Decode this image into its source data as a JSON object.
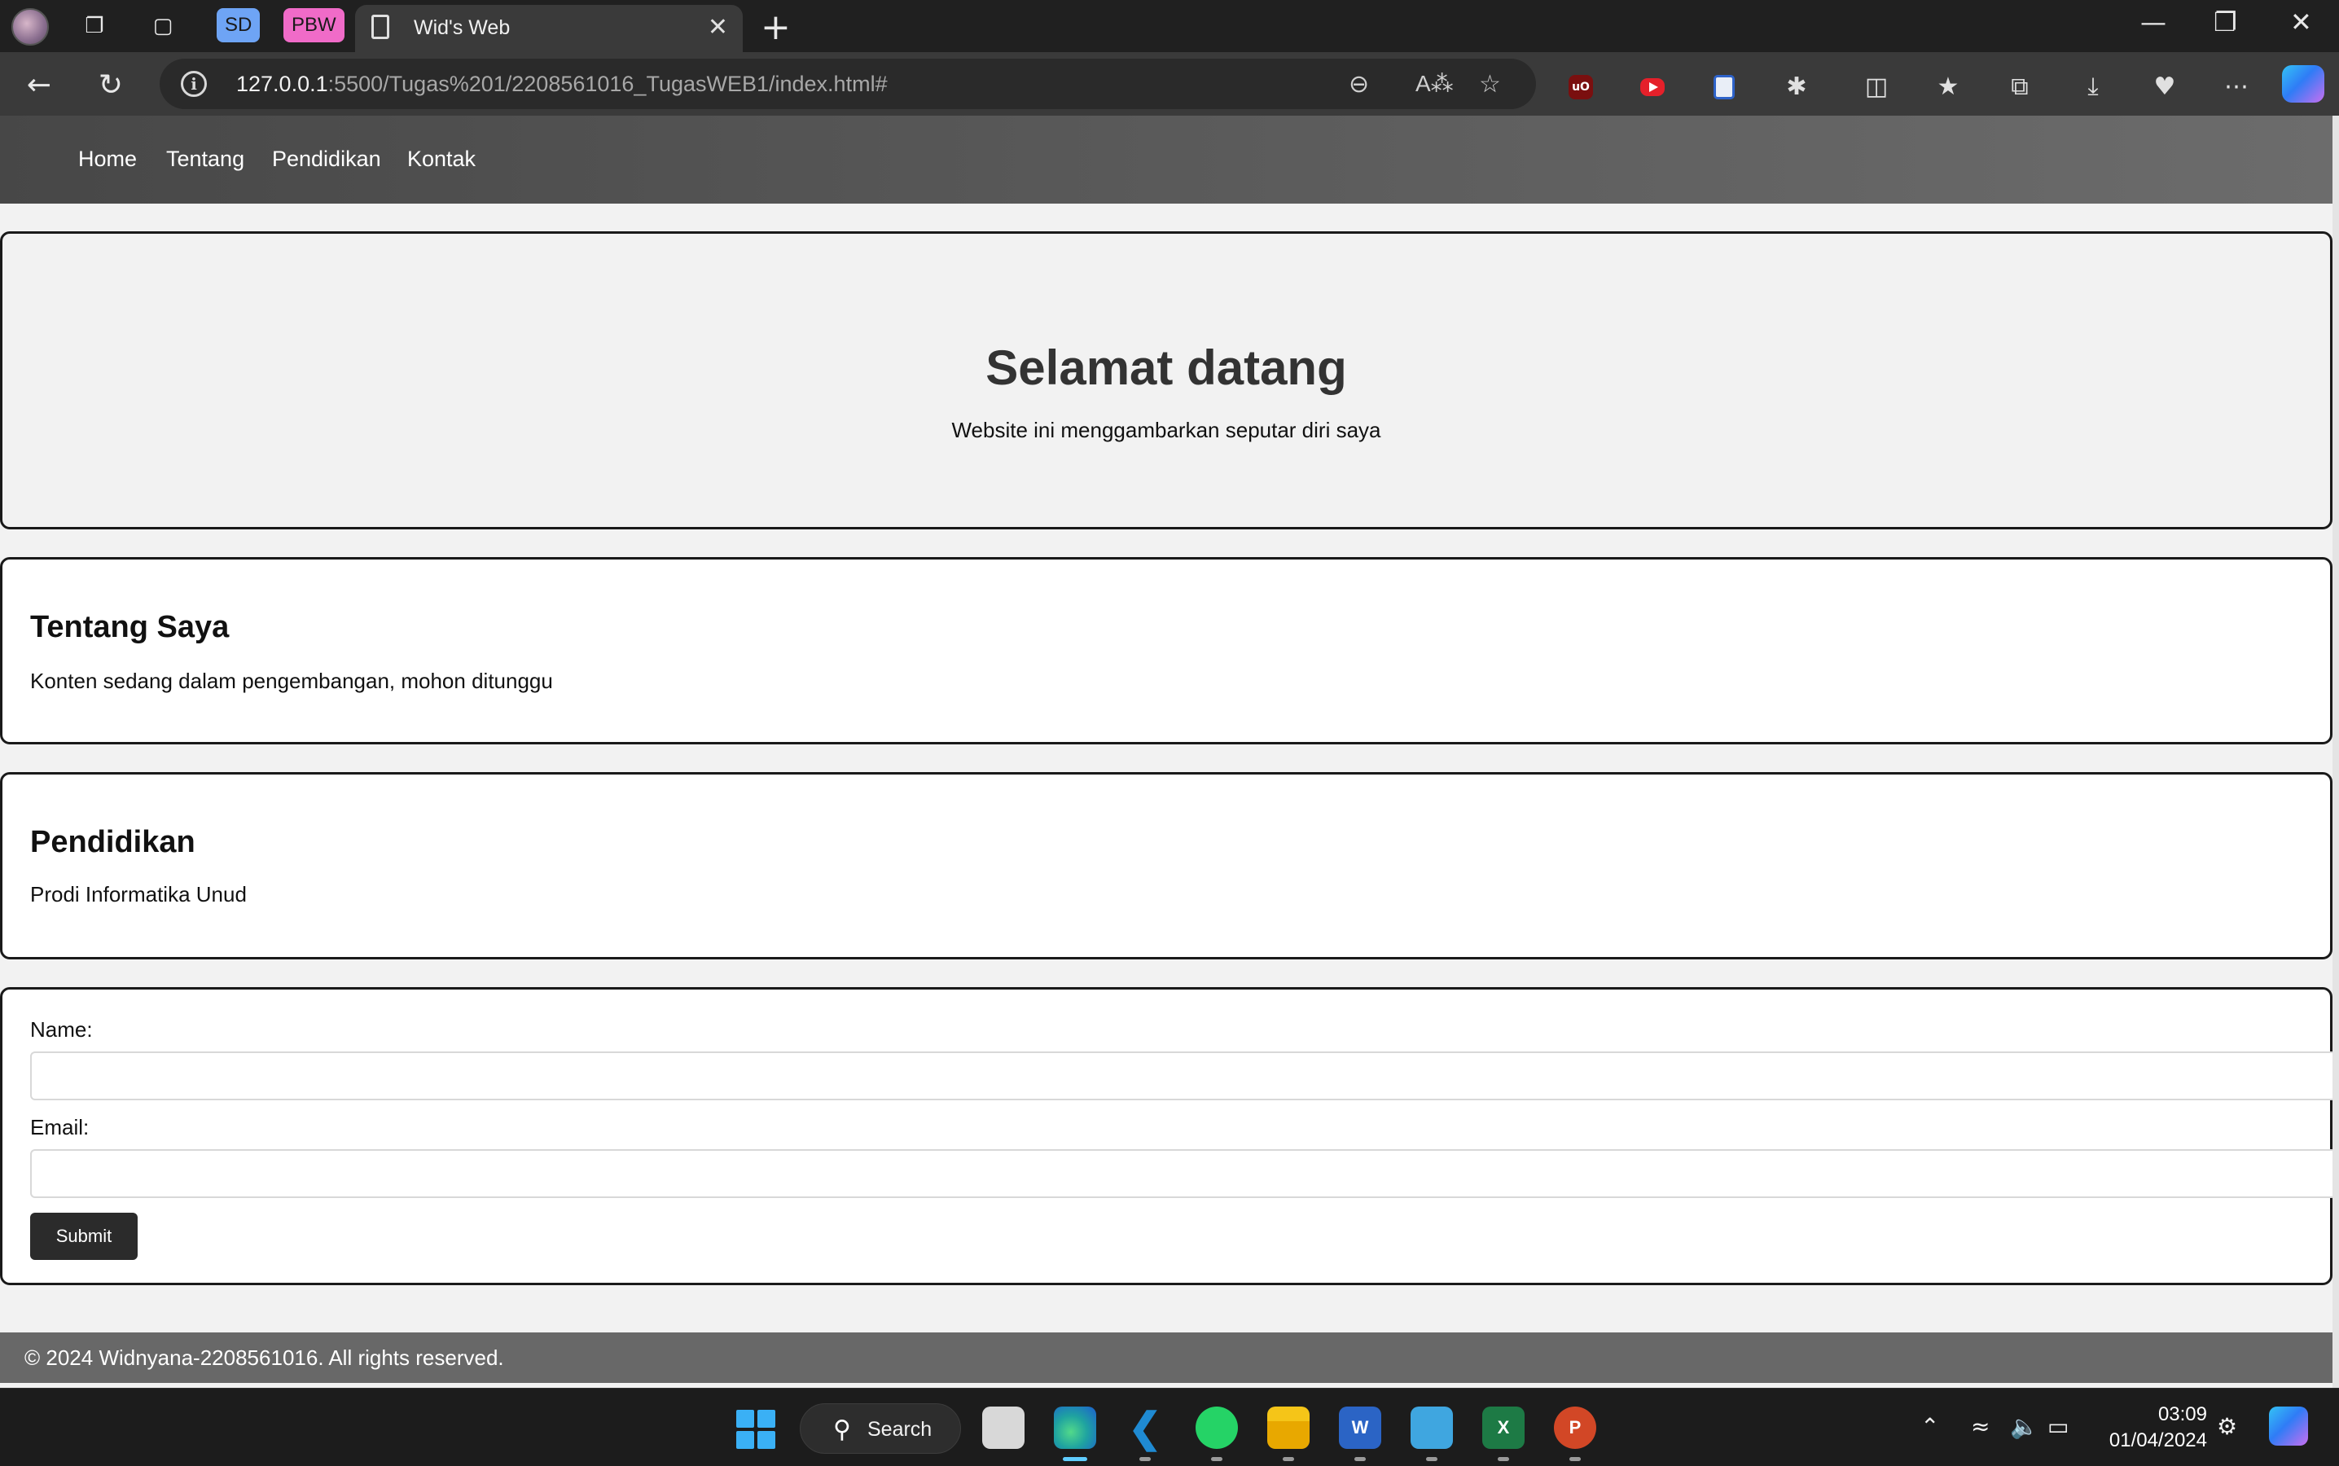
{
  "browser": {
    "tab_groups": [
      {
        "label": "SD",
        "color": "#6ea4f5"
      },
      {
        "label": "PBW",
        "color": "#f06bc8"
      }
    ],
    "active_tab": {
      "title": "Wid's Web"
    },
    "new_tab_symbol": "+",
    "address": {
      "host": "127.0.0.1",
      "path": ":5500/Tugas%201/2208561016_TugasWEB1/index.html#"
    },
    "extension_ub_label": "uO"
  },
  "site": {
    "nav": {
      "home": "Home",
      "tentang": "Tentang",
      "pendidikan": "Pendidikan",
      "kontak": "Kontak"
    },
    "hero": {
      "title": "Selamat datang",
      "subtitle": "Website ini menggambarkan seputar diri saya"
    },
    "about": {
      "title": "Tentang Saya",
      "text": "Konten sedang dalam pengembangan, mohon ditunggu"
    },
    "education": {
      "title": "Pendidikan",
      "text": "Prodi Informatika Unud"
    },
    "contact": {
      "name_label": "Name:",
      "name_value": "",
      "email_label": "Email:",
      "email_value": "",
      "submit_label": "Submit"
    },
    "footer": {
      "text": "© 2024 Widnyana-2208561016. All rights reserved."
    }
  },
  "taskbar": {
    "search_label": "Search",
    "apps": [
      {
        "name": "task-view",
        "letter": "",
        "color": "#d8d8d8"
      },
      {
        "name": "edge",
        "letter": "",
        "color": "#1fa3a0"
      },
      {
        "name": "vscode",
        "letter": "",
        "color": "#1f8ad2"
      },
      {
        "name": "whatsapp",
        "letter": "",
        "color": "#25d366"
      },
      {
        "name": "file-explorer",
        "letter": "",
        "color": "#f5c518"
      },
      {
        "name": "word",
        "letter": "W",
        "color": "#2b64c5"
      },
      {
        "name": "notepad",
        "letter": "",
        "color": "#3fa6e0"
      },
      {
        "name": "excel",
        "letter": "X",
        "color": "#1d7a45"
      },
      {
        "name": "powerpoint",
        "letter": "P",
        "color": "#d24726"
      }
    ],
    "clock": {
      "time": "03:09",
      "date": "01/04/2024"
    }
  },
  "colors": {
    "nav_gradient_start": "#474747",
    "nav_gradient_end": "#6c6c6c",
    "footer": "#686868",
    "submit": "#2b2b2b"
  }
}
